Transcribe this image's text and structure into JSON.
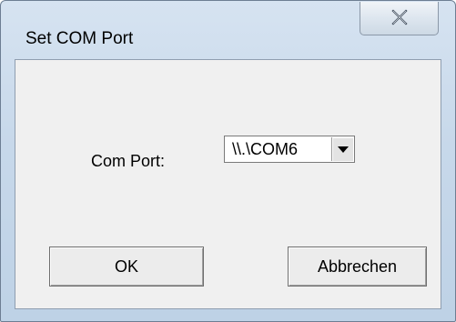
{
  "window": {
    "title": "Set COM Port",
    "close_icon": "close-icon"
  },
  "form": {
    "com_port_label": "Com Port:",
    "com_port_value": "\\\\.\\COM6",
    "dropdown_icon": "chevron-down-icon"
  },
  "buttons": {
    "ok_label": "OK",
    "cancel_label": "Abbrechen"
  },
  "colors": {
    "frame": "#c7d8ea",
    "client": "#f0f0f0",
    "button_face": "#ececec"
  }
}
